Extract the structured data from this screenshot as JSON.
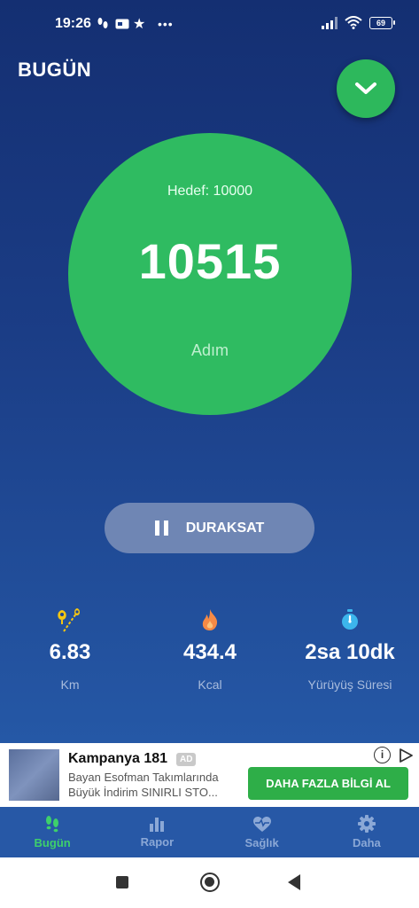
{
  "status_bar": {
    "time": "19:26",
    "battery": "69"
  },
  "header": {
    "title": "BUGÜN"
  },
  "steps": {
    "goal_label": "Hedef: 10000",
    "count": "10515",
    "unit": "Adım"
  },
  "pause_button": {
    "label": "DURAKSAT"
  },
  "stats": [
    {
      "value": "6.83",
      "label": "Km",
      "icon": "location-pins-icon",
      "color": "#f3c613"
    },
    {
      "value": "434.4",
      "label": "Kcal",
      "icon": "flame-icon",
      "color": "#f58a45"
    },
    {
      "value": "2sa 10dk",
      "label": "Yürüyüş Süresi",
      "icon": "stopwatch-icon",
      "color": "#3cb6ec"
    }
  ],
  "ad": {
    "title": "Kampanya 181",
    "badge": "AD",
    "line1": "Bayan Esofman Takımlarında",
    "line2": "Büyük İndirim  SINIRLI STO...",
    "cta": "DAHA FAZLA BİLGİ AL"
  },
  "tabs": [
    {
      "label": "Bugün",
      "icon": "footsteps-icon",
      "active": true
    },
    {
      "label": "Rapor",
      "icon": "bar-chart-icon",
      "active": false
    },
    {
      "label": "Sağlık",
      "icon": "heart-pulse-icon",
      "active": false
    },
    {
      "label": "Daha",
      "icon": "gear-icon",
      "active": false
    }
  ],
  "colors": {
    "accent_green": "#2fbb61",
    "background": "#1b3d86",
    "tab_active": "#3ed06b",
    "tab_inactive": "#8ba8d6"
  }
}
